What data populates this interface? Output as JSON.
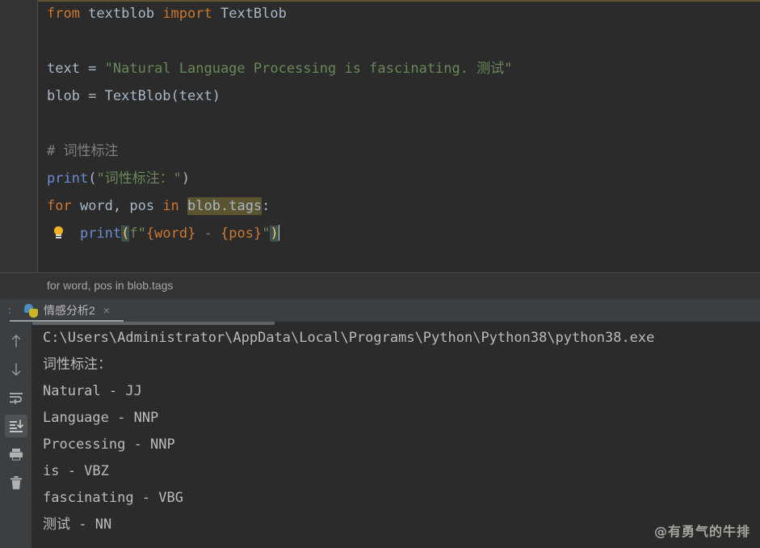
{
  "editor": {
    "lines": [
      {
        "id": "l1",
        "segments": [
          {
            "t": "from",
            "c": "kw"
          },
          {
            "t": " textblob ",
            "c": "plain"
          },
          {
            "t": "import",
            "c": "kw"
          },
          {
            "t": " TextBlob",
            "c": "plain"
          }
        ]
      },
      {
        "id": "l2",
        "segments": []
      },
      {
        "id": "l3",
        "segments": [
          {
            "t": "text = ",
            "c": "plain"
          },
          {
            "t": "\"Natural Language Processing is fascinating. 测试\"",
            "c": "str"
          }
        ]
      },
      {
        "id": "l4",
        "segments": [
          {
            "t": "blob = TextBlob(text)",
            "c": "plain"
          }
        ]
      },
      {
        "id": "l5",
        "segments": []
      },
      {
        "id": "l6",
        "segments": [
          {
            "t": "# 词性标注",
            "c": "cmt"
          }
        ]
      },
      {
        "id": "l7",
        "segments": [
          {
            "t": "print",
            "c": "fn"
          },
          {
            "t": "(",
            "c": "paren"
          },
          {
            "t": "\"词性标注：\"",
            "c": "str"
          },
          {
            "t": ")",
            "c": "paren"
          }
        ]
      },
      {
        "id": "l8",
        "segments": [
          {
            "t": "for",
            "c": "kw"
          },
          {
            "t": " word, pos ",
            "c": "plain"
          },
          {
            "t": "in",
            "c": "kw"
          },
          {
            "t": " ",
            "c": "plain"
          },
          {
            "t": "blob.tags",
            "c": "plain",
            "hl": "selection"
          },
          {
            "t": ":",
            "c": "plain"
          }
        ]
      },
      {
        "id": "l9",
        "segments": [
          {
            "t": "    ",
            "c": "plain"
          },
          {
            "t": "print",
            "c": "fn"
          },
          {
            "t": "(",
            "c": "plain",
            "hl": "paren"
          },
          {
            "t": "f",
            "c": "str"
          },
          {
            "t": "\"",
            "c": "str"
          },
          {
            "t": "{word}",
            "c": "brace"
          },
          {
            "t": " - ",
            "c": "str"
          },
          {
            "t": "{pos}",
            "c": "brace"
          },
          {
            "t": "\"",
            "c": "str"
          },
          {
            "t": ")",
            "c": "plain",
            "hl": "paren"
          }
        ],
        "bulb": true,
        "caret": true
      }
    ]
  },
  "breadcrumb": {
    "text": "for word, pos in blob.tags"
  },
  "tabbar": {
    "left_stub": ":",
    "tab_label": "情感分析2",
    "tab_close": "×",
    "tab_icon": "python-icon"
  },
  "console_toolbar": {
    "buttons": [
      {
        "name": "up-arrow-icon",
        "label": "Up the Stack Trace",
        "active": false
      },
      {
        "name": "down-arrow-icon",
        "label": "Down the Stack Trace",
        "active": false
      },
      {
        "name": "soft-wrap-icon",
        "label": "Soft-Wrap",
        "active": false
      },
      {
        "name": "scroll-to-end-icon",
        "label": "Scroll to End",
        "active": true
      },
      {
        "name": "print-icon",
        "label": "Print",
        "active": false
      },
      {
        "name": "trash-icon",
        "label": "Clear All",
        "active": false
      }
    ]
  },
  "console": {
    "lines": [
      "C:\\Users\\Administrator\\AppData\\Local\\Programs\\Python\\Python38\\python38.exe",
      "词性标注：",
      "Natural - JJ",
      "Language - NNP",
      "Processing - NNP",
      "is - VBZ",
      "fascinating - VBG",
      "测试 - NN"
    ]
  },
  "watermark": {
    "text": "@有勇气的牛排"
  },
  "colors": {
    "editor_bg": "#2b2b2b",
    "gutter_bg": "#313335",
    "panel_bg": "#3c3f41",
    "keyword": "#cc7832",
    "string": "#6a8759",
    "comment": "#808080",
    "function": "#6a8cd4",
    "default_text": "#a9b7c6",
    "selection_hl": "#5a5430",
    "paren_hl": "#3b514d",
    "console_text": "#bbbbbb"
  }
}
